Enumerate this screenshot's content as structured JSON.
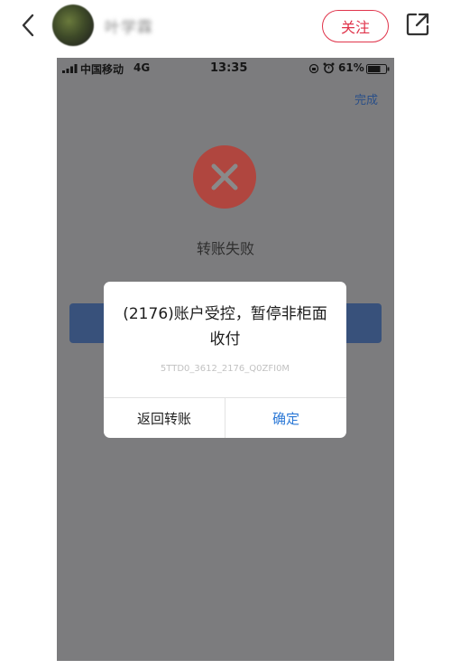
{
  "header": {
    "username": "叶学霖",
    "follow_label": "关注"
  },
  "status_bar": {
    "carrier": "中国移动",
    "network": "4G",
    "time": "13:35",
    "battery": "61%"
  },
  "page": {
    "done_label": "完成",
    "fail_title": "转账失败"
  },
  "dialog": {
    "message": "(2176)账户受控，暂停非柜面收付",
    "code": "5TTD0_3612_2176_Q0ZFI0M",
    "back_label": "返回转账",
    "confirm_label": "确定"
  },
  "colors": {
    "follow_accent": "#e0344b",
    "confirm_blue": "#2b78d6",
    "overlay_gray": "#7c7c7e",
    "error_red": "#b0463f"
  },
  "icons": [
    "back-chevron-icon",
    "share-icon",
    "signal-icon",
    "lock-rotation-icon",
    "alarm-icon",
    "battery-icon",
    "error-x-icon"
  ]
}
